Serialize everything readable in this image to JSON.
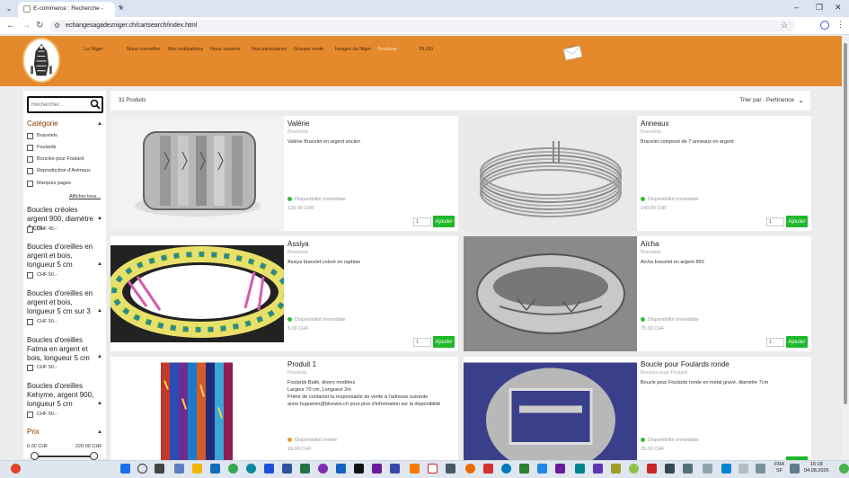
{
  "browser": {
    "tab_title": "E-commerce : Recherche - Echa",
    "url": "echangesagadezniger.ch/cartsearch/index.html"
  },
  "site_nav": [
    {
      "label": "Le Niger"
    },
    {
      "label": "Nous connaître"
    },
    {
      "label": "Nos réalisations"
    },
    {
      "label": "Nous soutenir"
    },
    {
      "label": "Nos partenaires"
    },
    {
      "label": "Groupe vente"
    },
    {
      "label": "Images du Niger"
    },
    {
      "label": "Boutique"
    },
    {
      "label": "BLOG"
    }
  ],
  "sidebar": {
    "search_placeholder": "Rechercher...",
    "category_title": "Catégorie",
    "categories": [
      {
        "label": "Bracelets"
      },
      {
        "label": "Foulards"
      },
      {
        "label": "Boucles pour Foulard"
      },
      {
        "label": "Reproduction d'Animaux"
      },
      {
        "label": "Marques pages"
      }
    ],
    "show_all": "Afficher tous...",
    "groups": [
      {
        "title": "Boucles créoles argent 900, diamètre 4 cm",
        "price": "CHF 45.-"
      },
      {
        "title": "Boucles d'oreilles en argent et bois, longueur 5 cm",
        "price": "CHF 50.-"
      },
      {
        "title": "Boucles d'oreilles en argent et bois, longueur 5 cm sur 3",
        "price": "CHF 50.-"
      },
      {
        "title": "Boucles d'oreilles Fatma en argent et bois, longueur 5 cm",
        "price": "CHF 50.-"
      },
      {
        "title": "Boucles d'oreilles Kehyme, argent 900, longueur 5 cm",
        "price": "CHF 50.-"
      }
    ],
    "price_title": "Prix",
    "price_min": "0.00 CHF",
    "price_max": "220.00 CHF"
  },
  "topbar": {
    "count": "31 Produits",
    "sort": "Trier par : Pertinence"
  },
  "products": [
    {
      "name": "Valérie",
      "category": "Bracelets",
      "desc": "Valérie Bracelet en argent ancien",
      "availability": "Disponibilité immédiate",
      "avail_color": "#3cb83c",
      "price": "120.00 CHF",
      "qty": "1",
      "add": "Ajouter"
    },
    {
      "name": "Anneaux",
      "category": "Bracelets",
      "desc": "Bracelet composé de 7 anneaux en argent",
      "availability": "Disponibilité immédiate",
      "avail_color": "#3cb83c",
      "price": "140.00 CHF",
      "qty": "1",
      "add": "Ajouter"
    },
    {
      "name": "Assiya",
      "category": "Bracelets",
      "desc": "Assiya bracelet coloré en raphias",
      "availability": "Disponibilité immédiate",
      "avail_color": "#3cb83c",
      "price": "3.00 CHF",
      "qty": "1",
      "add": "Ajouter"
    },
    {
      "name": "Aïcha",
      "category": "Bracelets",
      "desc": "Aïcha bracelet en argent 850",
      "availability": "Disponibilité immédiate",
      "avail_color": "#3cb83c",
      "price": "75.00 CHF",
      "qty": "1",
      "add": "Ajouter"
    },
    {
      "name": "Produit 1",
      "category": "Foulards",
      "desc": "Foulards Batik, divers modèles\nLargeur 70 cm, Longueur 2m\nPrière de contacter la responsable de vente à l'adresse suivante anne.huguenin@bluewin.ch pour plus d'information sur la disponibilité",
      "availability": "Disponibilité limitée",
      "avail_color": "#e0a030",
      "price": "18.00 CHF",
      "qty": "",
      "add": ""
    },
    {
      "name": "Boucle pour Foulards ronde",
      "category": "Boucles pour Foulard",
      "desc": "Boucle pour Foulards ronde en métal gravé, diamètre 7cm",
      "availability": "Disponibilité immédiate",
      "avail_color": "#3cb83c",
      "price": "25.00 CHF",
      "qty": "",
      "add": ""
    }
  ],
  "taskbar": {
    "lang": "FRA",
    "region": "SF",
    "time": "16:18",
    "date": "04.08.2026"
  }
}
